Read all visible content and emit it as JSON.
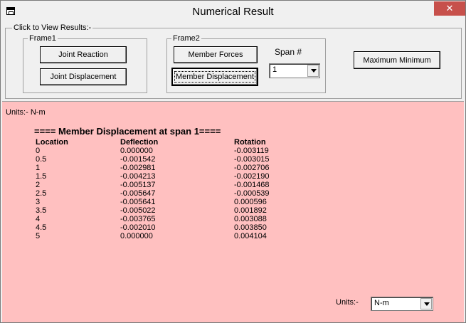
{
  "window": {
    "title": "Numerical Result",
    "close_glyph": "✕"
  },
  "top_panel": {
    "group_label": "Click to View Results:-",
    "frame1": {
      "label": "Frame1",
      "joint_reaction": "Joint Reaction",
      "joint_displacement": "Joint Displacement"
    },
    "frame2": {
      "label": "Frame2",
      "member_forces": "Member Forces",
      "member_displacement": "Member Displacement",
      "span_label": "Span #",
      "span_value": "1"
    },
    "max_min": "Maximum Minimum"
  },
  "results": {
    "units_line": "Units:-  N-m",
    "heading": "==== Member Displacement at span 1====",
    "columns": [
      "Location",
      "Deflection",
      "Rotation"
    ],
    "rows": [
      [
        "0",
        "0.000000",
        "-0.003119"
      ],
      [
        "0.5",
        "-0.001542",
        "-0.003015"
      ],
      [
        "1",
        "-0.002981",
        "-0.002706"
      ],
      [
        "1.5",
        "-0.004213",
        "-0.002190"
      ],
      [
        "2",
        "-0.005137",
        "-0.001468"
      ],
      [
        "2.5",
        "-0.005647",
        "-0.000539"
      ],
      [
        "3",
        "-0.005641",
        "0.000596"
      ],
      [
        "3.5",
        "-0.005022",
        "0.001892"
      ],
      [
        "4",
        "-0.003765",
        "0.003088"
      ],
      [
        "4.5",
        "-0.002010",
        "0.003850"
      ],
      [
        "5",
        "0.000000",
        "0.004104"
      ]
    ],
    "units_label": "Units:-",
    "units_value": "N-m"
  }
}
